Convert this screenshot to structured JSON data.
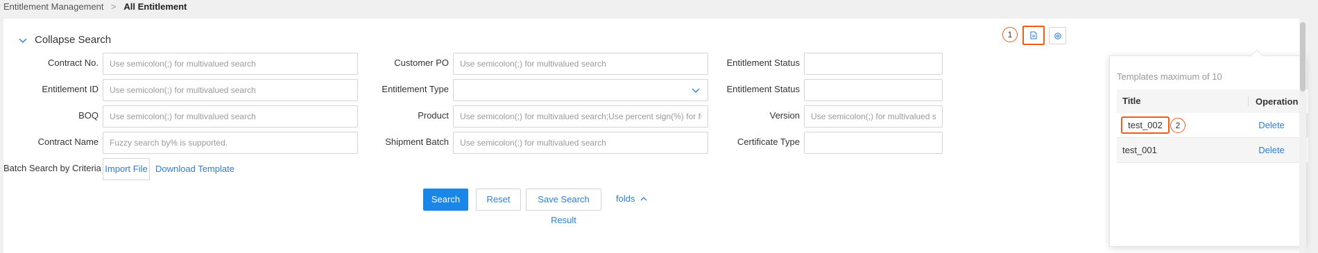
{
  "breadcrumb": {
    "parent": "Entitlement Management",
    "separator": ">",
    "current": "All Entitlement"
  },
  "search_panel": {
    "collapse_label": "Collapse Search",
    "fields": {
      "contract_no": {
        "label": "Contract No.",
        "placeholder": "Use semicolon(;) for multivalued search",
        "value": ""
      },
      "entitlement_id": {
        "label": "Entitlement ID",
        "placeholder": "Use semicolon(;) for multivalued search",
        "value": ""
      },
      "boq": {
        "label": "BOQ",
        "placeholder": "Use semicolon(;) for multivalued search",
        "value": ""
      },
      "contract_name": {
        "label": "Contract Name",
        "placeholder": "Fuzzy search by% is supported.",
        "value": ""
      },
      "customer_po": {
        "label": "Customer PO",
        "placeholder": "Use semicolon(;) for multivalued search",
        "value": ""
      },
      "entitlement_type": {
        "label": "Entitlement Type",
        "value": ""
      },
      "product": {
        "label": "Product",
        "placeholder": "Use semicolon(;) for multivalued search;Use percent sign(%) for fuzzy ...",
        "value": ""
      },
      "shipment_batch": {
        "label": "Shipment Batch",
        "placeholder": "Use semicolon(;) for multivalued search",
        "value": ""
      },
      "entitlement_status_1": {
        "label": "Entitlement Status",
        "value": ""
      },
      "entitlement_status_2": {
        "label": "Entitlement Status",
        "value": ""
      },
      "version": {
        "label": "Version",
        "placeholder": "Use semicolon(;) for multivalued search",
        "value": ""
      },
      "certificate_type": {
        "label": "Certificate Type",
        "value": ""
      }
    },
    "batch": {
      "label": "Batch Search by Criteria",
      "import_label": "Import File",
      "download_label": "Download Template"
    },
    "actions": {
      "search": "Search",
      "reset": "Reset",
      "save": "Save Search Result",
      "folds": "folds"
    }
  },
  "markers": {
    "one": "1",
    "two": "2"
  },
  "templates_popover": {
    "title": "Templates maximum of 10",
    "columns": {
      "title": "Title",
      "operation": "Operation"
    },
    "rows": [
      {
        "title": "test_002",
        "action": "Delete"
      },
      {
        "title": "test_001",
        "action": "Delete"
      }
    ]
  },
  "icons": {
    "collapse": "chevron-down-icon",
    "template": "document-icon",
    "settings": "gear-icon",
    "select_caret": "chevron-down-icon",
    "folds": "chevron-up-icon"
  },
  "colors": {
    "accent": "#1a86e8",
    "link": "#2b7fd9",
    "highlight": "#f05a12"
  }
}
